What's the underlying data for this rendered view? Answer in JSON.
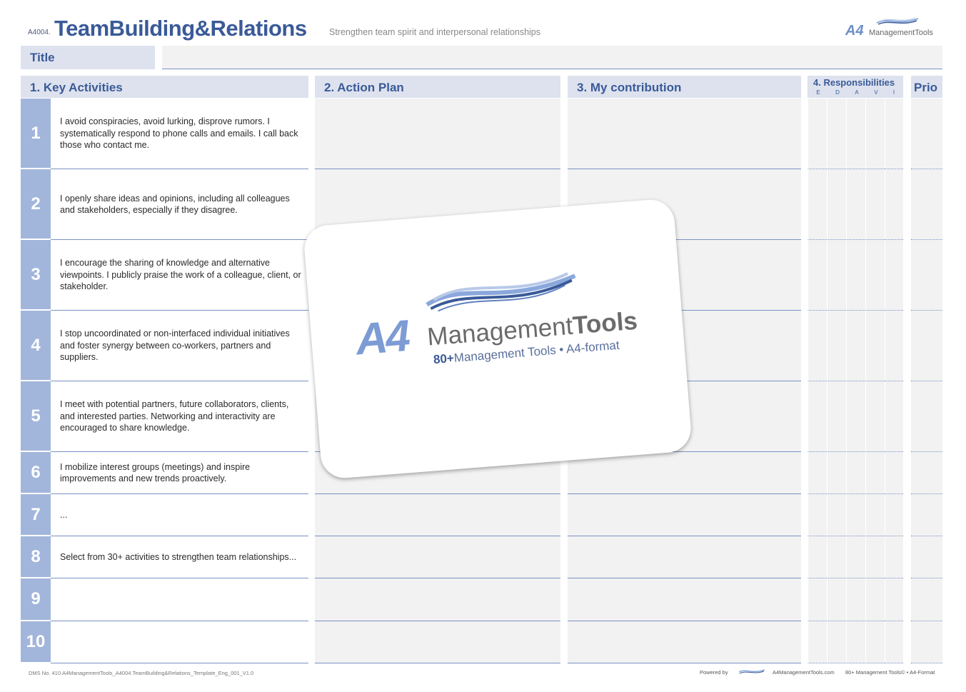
{
  "header": {
    "code": "A4004.",
    "title": "TeamBuilding&Relations",
    "subtitle": "Strengthen team spirit and interpersonal relationships",
    "logo_a4": "A4",
    "logo_text": "ManagementTools"
  },
  "title_label": "Title",
  "columns": {
    "key_activities": "1. Key Activities",
    "action_plan": "2. Action Plan",
    "my_contribution": "3. My contribution",
    "responsibilities": "4. Responsibilities",
    "resp_letters": [
      "E",
      "D",
      "A",
      "V",
      "I"
    ],
    "prio": "Prio"
  },
  "rows": [
    {
      "num": "1",
      "text": "I avoid conspiracies, avoid lurking, disprove rumors. I systematically respond to phone calls and emails. I call back those who contact me."
    },
    {
      "num": "2",
      "text": "I openly share ideas and opinions, including all colleagues and stakeholders, especially if they disagree."
    },
    {
      "num": "3",
      "text": "I encourage the sharing of knowledge and alternative viewpoints. I publicly praise the work of a colleague, client, or stakeholder."
    },
    {
      "num": "4",
      "text": "I stop uncoordinated or non-interfaced individual initiatives and foster synergy between co-workers, partners and suppliers."
    },
    {
      "num": "5",
      "text": "I meet with potential partners, future collaborators, clients, and interested parties. Networking and interactivity are encouraged to share knowledge."
    },
    {
      "num": "6",
      "text": "I mobilize interest groups (meetings) and inspire improvements and new trends proactively."
    },
    {
      "num": "7",
      "text": "..."
    },
    {
      "num": "8",
      "text": "Select from 30+ activities to strengthen team relationships..."
    },
    {
      "num": "9",
      "text": ""
    },
    {
      "num": "10",
      "text": ""
    }
  ],
  "overlay": {
    "a4": "A4",
    "management": "Management",
    "tools": "Tools",
    "tag_count": "80+",
    "tag_rest": "Management Tools • A4-format"
  },
  "footer": {
    "dms": "DMS No. 410.A4ManagementTools_A4004.TeamBuilding&Relations_Template_Eng_001_V1.0",
    "powered": "Powered by",
    "site": "A4ManagementTools.com",
    "tag": "80+ Management Tools© • A4-Format"
  },
  "colors": {
    "accent": "#3a5a98",
    "number_band": "#a2b6dc",
    "header_fill": "#dde2ee",
    "cell_fill": "#f2f2f2"
  }
}
